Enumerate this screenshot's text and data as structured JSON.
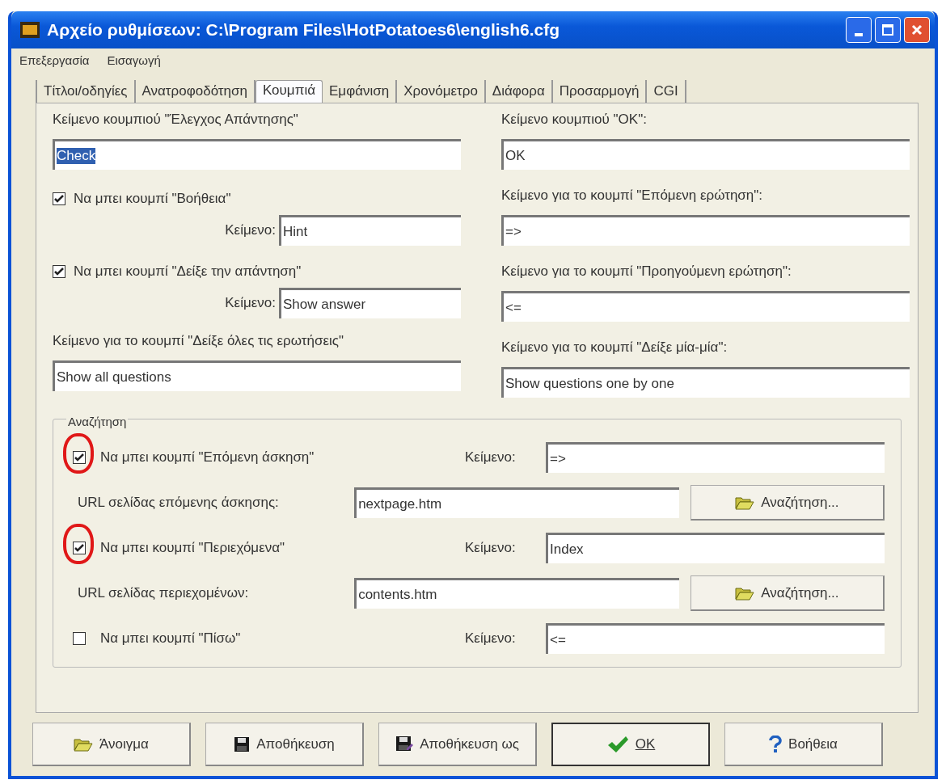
{
  "window": {
    "title": "Αρχείο ρυθμίσεων: C:\\Program Files\\HotPotatoes6\\english6.cfg"
  },
  "menu": [
    "Επεξεργασία",
    "Εισαγωγή"
  ],
  "tabs": [
    {
      "label": "Τίτλοι/οδηγίες",
      "selected": false
    },
    {
      "label": "Ανατροφοδότηση",
      "selected": false
    },
    {
      "label": "Κουμπιά",
      "selected": true
    },
    {
      "label": "Εμφάνιση",
      "selected": false
    },
    {
      "label": "Χρονόμετρο",
      "selected": false
    },
    {
      "label": "Διάφορα",
      "selected": false
    },
    {
      "label": "Προσαρμογή",
      "selected": false
    },
    {
      "label": "CGI",
      "selected": false
    }
  ],
  "left_column": [
    {
      "kind": "text",
      "label": "Κείμενο κουμπιού \"Έλεγχος Απάντησης\"",
      "value": "Check",
      "selected": true
    },
    {
      "kind": "checkbox",
      "label": "Να μπει κουμπί \"Βοήθεια\"",
      "checked": true,
      "text_label": "Κείμενο:",
      "value": "Hint"
    },
    {
      "kind": "checkbox",
      "label": "Να μπει κουμπί \"Δείξε την απάντηση\"",
      "checked": true,
      "text_label": "Κείμενο:",
      "value": "Show answer"
    },
    {
      "kind": "text",
      "label": "Κείμενο για το κουμπί \"Δείξε όλες τις ερωτήσεις\"",
      "value": "Show all questions",
      "selected": false
    }
  ],
  "right_column": [
    {
      "kind": "text",
      "label": "Κείμενο κουμπιού \"OK\":",
      "value": "OK",
      "selected": false
    },
    {
      "kind": "text",
      "label": "Κείμενο για το κουμπί \"Επόμενη ερώτηση\":",
      "value": "=>",
      "selected": false
    },
    {
      "kind": "text",
      "label": "Κείμενο για το κουμπί \"Προηγούμενη ερώτηση\":",
      "value": "<=",
      "selected": false
    },
    {
      "kind": "text",
      "label": "Κείμενο για το κουμπί \"Δείξε μία-μία\":",
      "value": "Show questions one by one",
      "selected": false
    }
  ],
  "navigation": {
    "title": "Αναζήτηση",
    "rows": [
      {
        "kind": "checkbox",
        "label": "Να μπει κουμπί \"Επόμενη άσκηση\"",
        "checked": true,
        "circled": true,
        "text_label": "Κείμενο:",
        "value": "=>"
      },
      {
        "kind": "url",
        "label": "URL σελίδας επόμενης άσκησης:",
        "value": "nextpage.htm",
        "button": "Αναζήτηση..."
      },
      {
        "kind": "checkbox",
        "label": "Να μπει κουμπί \"Περιεχόμενα\"",
        "checked": true,
        "circled": true,
        "text_label": "Κείμενο:",
        "value": "Index"
      },
      {
        "kind": "url",
        "label": "URL σελίδας περιεχομένων:",
        "value": "contents.htm",
        "button": "Αναζήτηση..."
      },
      {
        "kind": "checkbox",
        "label": "Να μπει κουμπί \"Πίσω\"",
        "checked": false,
        "circled": false,
        "text_label": "Κείμενο:",
        "value": "<="
      }
    ]
  },
  "buttons": [
    {
      "kind": "open",
      "label": "Άνοιγμα"
    },
    {
      "kind": "save",
      "label": "Αποθήκευση"
    },
    {
      "kind": "save_as",
      "label": "Αποθήκευση ως"
    },
    {
      "kind": "ok",
      "label": "OK"
    },
    {
      "kind": "help",
      "label": "Βοήθεια"
    }
  ]
}
